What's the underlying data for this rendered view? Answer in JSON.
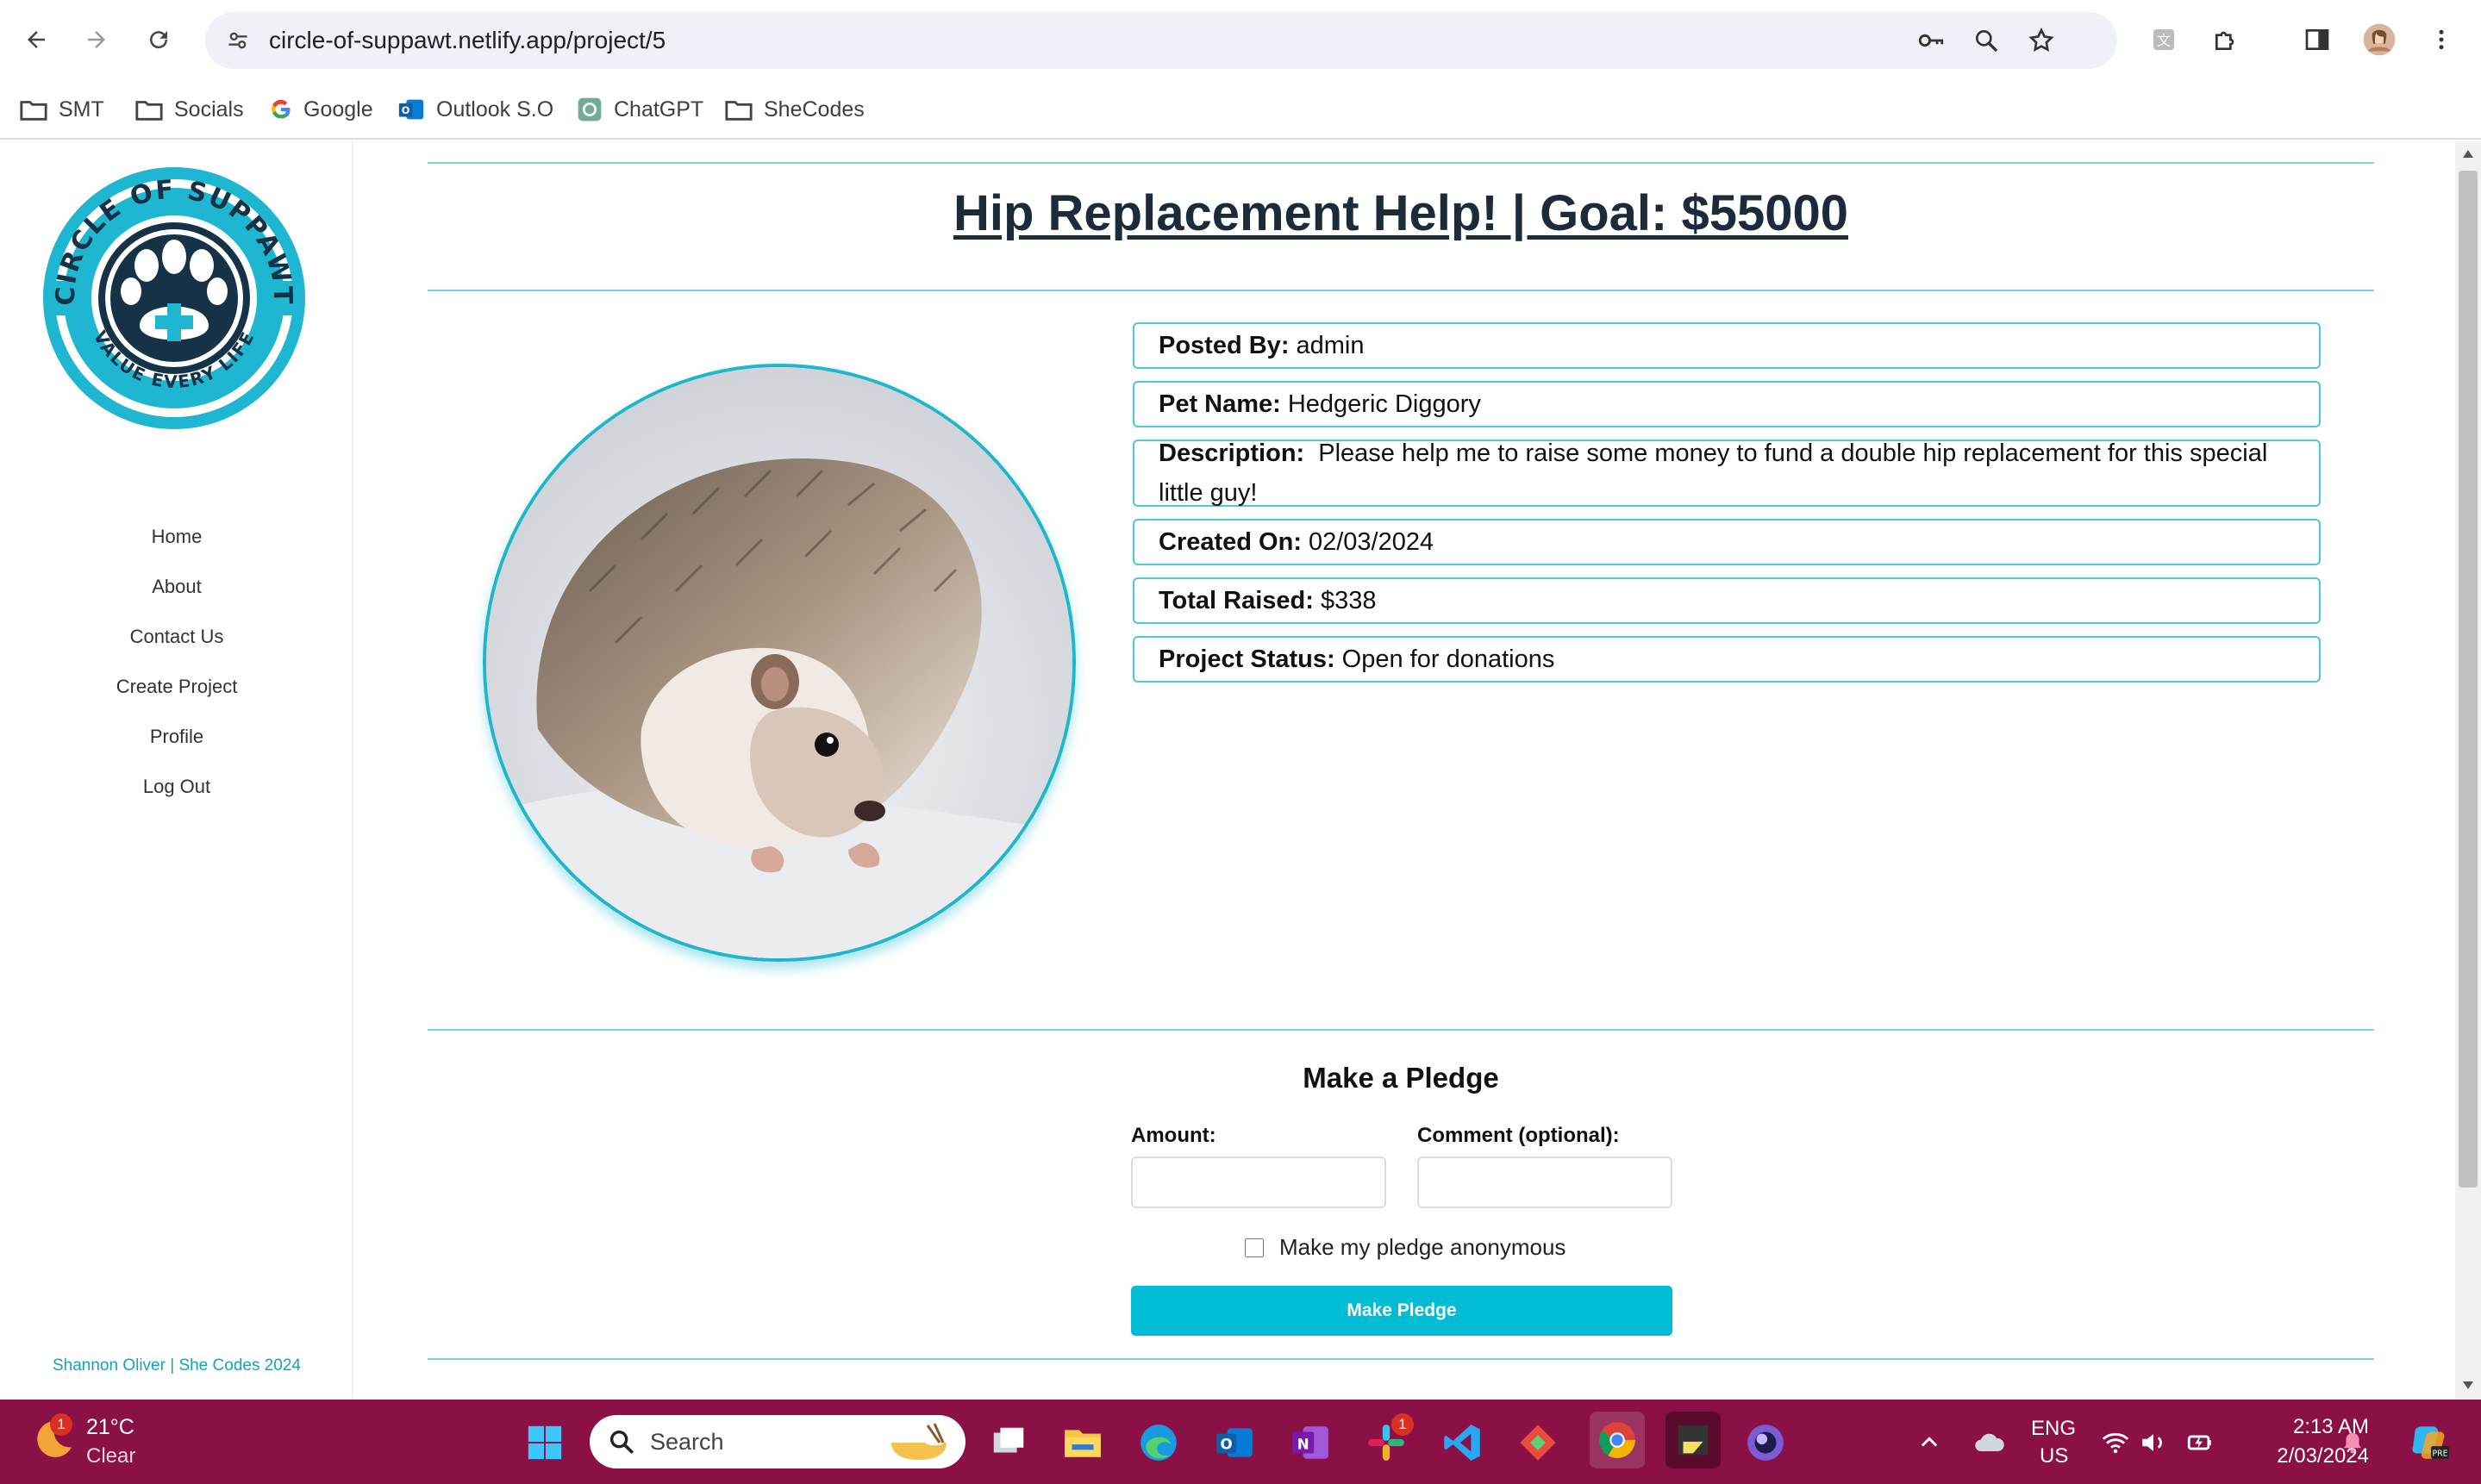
{
  "browser": {
    "url": "circle-of-suppawt.netlify.app/project/5",
    "bookmarks": [
      {
        "label": "SMT",
        "icon": "folder-icon"
      },
      {
        "label": "Socials",
        "icon": "folder-icon"
      },
      {
        "label": "Google",
        "icon": "google-icon"
      },
      {
        "label": "Outlook S.O",
        "icon": "outlook-icon"
      },
      {
        "label": "ChatGPT",
        "icon": "chatgpt-icon"
      },
      {
        "label": "SheCodes",
        "icon": "folder-icon"
      }
    ]
  },
  "logo": {
    "top_text": "CIRCLE OF SUPPAWT",
    "bottom_text": "VALUE EVERY LIFE"
  },
  "sidebar": {
    "items": [
      {
        "label": "Home"
      },
      {
        "label": "About"
      },
      {
        "label": "Contact Us"
      },
      {
        "label": "Create Project"
      },
      {
        "label": "Profile"
      },
      {
        "label": "Log Out"
      }
    ],
    "footer": "Shannon Oliver | She Codes 2024"
  },
  "project": {
    "title": "Hip Replacement Help! | Goal: $55000",
    "image_alt": "hedgehog",
    "posted_by_label": "Posted By:",
    "posted_by": "admin",
    "pet_name_label": "Pet Name:",
    "pet_name": "Hedgeric Diggory",
    "description_label": "Description:",
    "description": "Please help me to raise some money to fund a double hip replacement for this special little guy!",
    "created_label": "Created On:",
    "created": "02/03/2024",
    "raised_label": "Total Raised:",
    "raised": "$338",
    "status_label": "Project Status:",
    "status": "Open for donations"
  },
  "pledge": {
    "title": "Make a Pledge",
    "amount_label": "Amount:",
    "amount_value": "",
    "comment_label": "Comment (optional):",
    "comment_value": "",
    "anonymous_label": "Make my pledge anonymous",
    "button_label": "Make Pledge"
  },
  "taskbar": {
    "weather_temp": "21°C",
    "weather_desc": "Clear",
    "weather_badge": "1",
    "search_placeholder": "Search",
    "slack_badge": "1",
    "lang_top": "ENG",
    "lang_bottom": "US",
    "time": "2:13 AM",
    "date": "2/03/2024"
  },
  "colors": {
    "accent": "#00bcd4",
    "title": "#1c2b3a",
    "taskbar": "#8a1046",
    "card_border": "#4fc7d4"
  }
}
